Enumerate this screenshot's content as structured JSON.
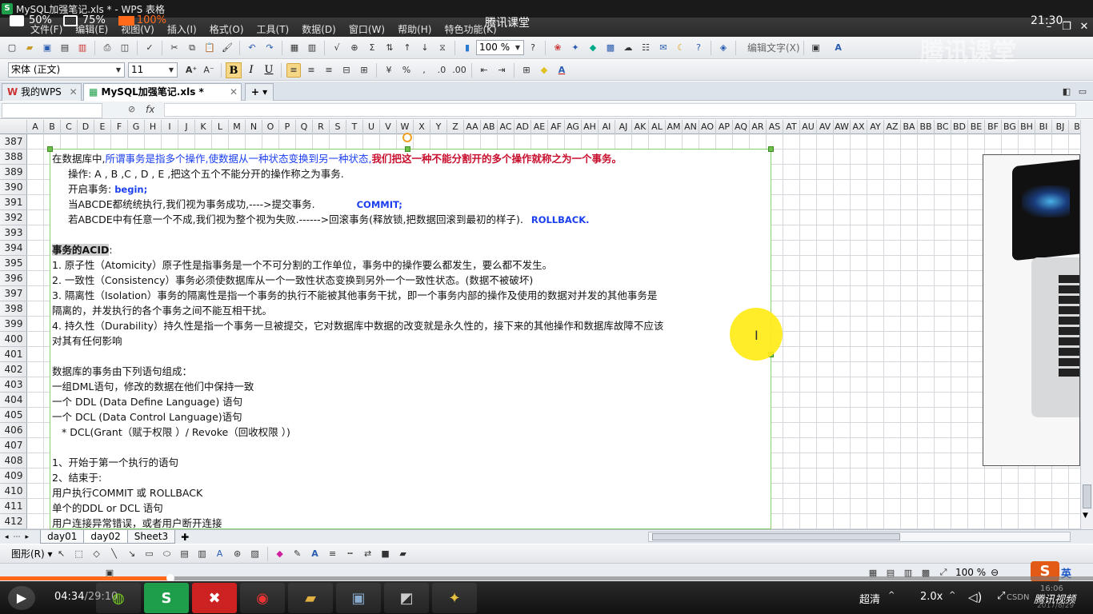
{
  "window": {
    "title": "MySQL加强笔记.xls * - WPS 表格",
    "icon": "S"
  },
  "overlay": {
    "left_status": "50%",
    "monitor_status": "75%",
    "battery_status": "100%",
    "center_brand": "腾讯课堂",
    "clock": "21:30"
  },
  "menu": {
    "items": [
      "文件(F)",
      "编辑(E)",
      "视图(V)",
      "插入(I)",
      "格式(O)",
      "工具(T)",
      "数据(D)",
      "窗口(W)",
      "帮助(H)",
      "特色功能(K)"
    ]
  },
  "toolbar1": {
    "zoom": "100 %",
    "edit_text": "编辑文字(X)"
  },
  "toolbar2": {
    "font_name": "宋体 (正文)",
    "font_size": "11",
    "bold": "B",
    "italic": "I",
    "underline": "U"
  },
  "tabs": [
    {
      "label": "我的WPS"
    },
    {
      "label": "MySQL加强笔记.xls *"
    }
  ],
  "formula": {
    "fx": "fx",
    "name_box": ""
  },
  "columns": [
    "A",
    "B",
    "C",
    "D",
    "E",
    "F",
    "G",
    "H",
    "I",
    "J",
    "K",
    "L",
    "M",
    "N",
    "O",
    "P",
    "Q",
    "R",
    "S",
    "T",
    "U",
    "V",
    "W",
    "X",
    "Y",
    "Z",
    "AA",
    "AB",
    "AC",
    "AD",
    "AE",
    "AF",
    "AG",
    "AH",
    "AI",
    "AJ",
    "AK",
    "AL",
    "AM",
    "AN",
    "AO",
    "AP",
    "AQ",
    "AR",
    "AS",
    "AT",
    "AU",
    "AV",
    "AW",
    "AX",
    "AY",
    "AZ",
    "BA",
    "BB",
    "BC",
    "BD",
    "BE",
    "BF",
    "BG",
    "BH",
    "BI",
    "BJ",
    "B"
  ],
  "rows": [
    "387",
    "388",
    "389",
    "390",
    "391",
    "392",
    "393",
    "394",
    "395",
    "396",
    "397",
    "398",
    "399",
    "400",
    "401",
    "402",
    "403",
    "404",
    "405",
    "406",
    "407",
    "408",
    "409",
    "410",
    "411",
    "412"
  ],
  "notes": {
    "l388a": "在数据库中,",
    "l388b": "所谓事务是指多个操作,使数据从一种状态变换到另一种状态,",
    "l388c": "我们把这一种不能分割开的多个操作就称之为一个事务。",
    "l389": "操作: A , B ,C , D , E ,把这个五个不能分开的操作称之为事务.",
    "l390a": "开启事务: ",
    "l390b": "begin;",
    "l391a": "当ABCDE都统统执行,我们视为事务成功,---->提交事务.",
    "l391b": "COMMIT;",
    "l392a": "若ABCDE中有任意一个不成,我们视为整个视为失败.------>回滚事务(释放锁,把数据回滚到最初的样子).",
    "l392b": "ROLLBACK.",
    "l394a": "事务的ACID",
    "l394b": ":",
    "l395": "1. 原子性（Atomicity）原子性是指事务是一个不可分割的工作单位，事务中的操作要么都发生，要么都不发生。",
    "l396": "2. 一致性（Consistency）事务必须使数据库从一个一致性状态变换到另外一个一致性状态。(数据不被破坏)",
    "l397": "3. 隔离性（Isolation）事务的隔离性是指一个事务的执行不能被其他事务干扰，即一个事务内部的操作及使用的数据对并发的其他事务是",
    "l398": "隔离的，并发执行的各个事务之间不能互相干扰。",
    "l399": "4. 持久性（Durability）持久性是指一个事务一旦被提交，它对数据库中数据的改变就是永久性的，接下来的其他操作和数据库故障不应该",
    "l400": "对其有任何影响",
    "l402": "数据库的事务由下列语句组成：",
    "l403": "一组DML语句，修改的数据在他们中保持一致",
    "l404": "一个 DDL (Data Define Language) 语句",
    "l405": "一个 DCL (Data Control Language)语句",
    "l406": "* DCL(Grant（赋于权限 ）/ Revoke（回收权限 ）)",
    "l408": "1、开始于第一个执行的语句",
    "l409": "2、结束于:",
    "l410": "用户执行COMMIT 或 ROLLBACK",
    "l411": "单个的DDL or DCL 语句",
    "l412": "用户连接异常错误，或者用户断开连接"
  },
  "sheets": [
    "day01",
    "day02",
    "Sheet3"
  ],
  "status": {
    "zoom": "100 %"
  },
  "player": {
    "time_current": "04:34",
    "time_total": "29:10",
    "quality": "超清",
    "speed": "2.0x",
    "ime": "英",
    "watermark": "腾讯视频",
    "date_time": "16:06",
    "date": "2017/8/29",
    "csdn": "CSDN"
  },
  "colors": {
    "accent_orange": "#ff6a1a",
    "text_blue": "#1a3ef0",
    "text_red": "#c8102e",
    "selection_green": "#6cc04a"
  }
}
